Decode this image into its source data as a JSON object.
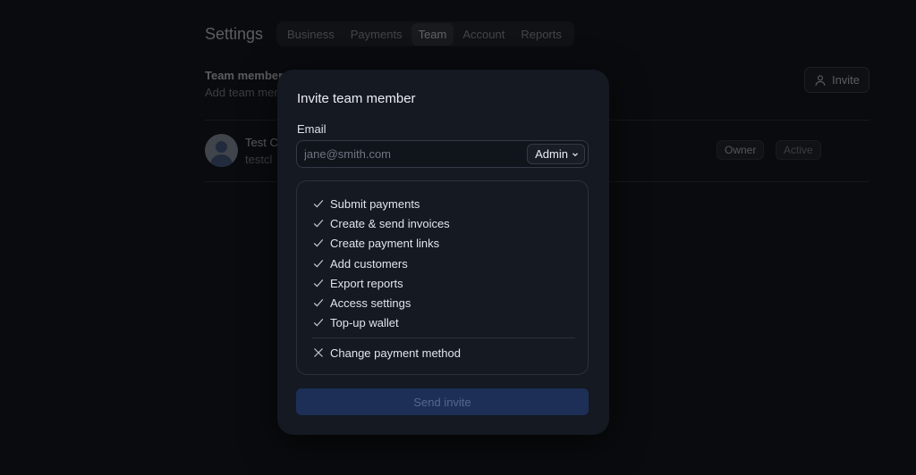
{
  "header": {
    "title": "Settings",
    "tabs": [
      {
        "label": "Business"
      },
      {
        "label": "Payments"
      },
      {
        "label": "Team",
        "active": true
      },
      {
        "label": "Account"
      },
      {
        "label": "Reports"
      }
    ]
  },
  "team_section": {
    "title": "Team members",
    "description": "Add team members and manage their permissions.",
    "invite_label": "Invite",
    "members": [
      {
        "name": "Test C",
        "email": "testcl",
        "role": "Owner",
        "status": "Active"
      }
    ]
  },
  "modal": {
    "title": "Invite team member",
    "email_label": "Email",
    "email_placeholder": "jane@smith.com",
    "role": "Admin",
    "permissions_allowed": [
      "Submit payments",
      "Create & send invoices",
      "Create payment links",
      "Add customers",
      "Export reports",
      "Access settings",
      "Top-up wallet"
    ],
    "permissions_denied": [
      "Change payment method"
    ],
    "submit_label": "Send invite"
  },
  "icons": {
    "allowed": "check-icon",
    "denied": "x-icon",
    "invite": "user-icon",
    "dropdown": "chevron-down-icon"
  },
  "colors": {
    "modal_bg": "#141922",
    "primary_disabled": "#1e2f57"
  }
}
